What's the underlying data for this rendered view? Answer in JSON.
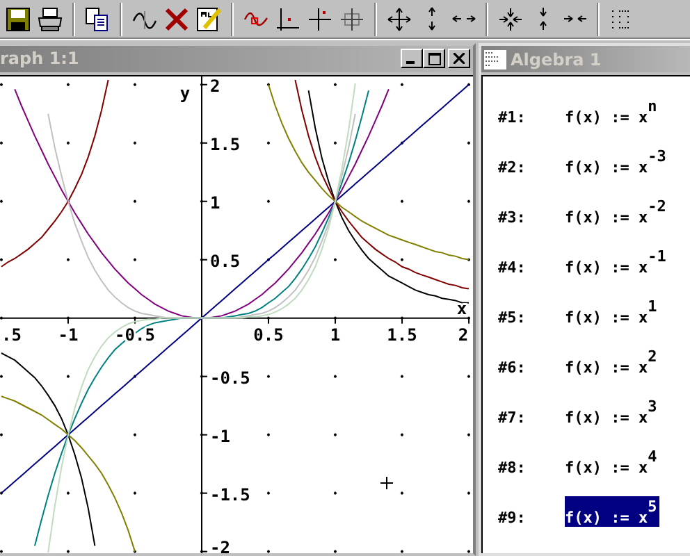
{
  "graph_window": {
    "title": "raph 1:1",
    "cut_tick_label": ".5",
    "chart_data": {
      "type": "line",
      "xlabel": "x",
      "ylabel": "y",
      "x": [
        -1.5,
        -1.45,
        -1.4,
        -1.35,
        -1.3,
        -1.25,
        -1.2,
        -1.15,
        -1.1,
        -1.05,
        -1,
        -0.95,
        -0.9,
        -0.85,
        -0.8,
        -0.75,
        -0.7,
        -0.65,
        -0.6,
        -0.55,
        -0.5,
        -0.45,
        -0.4,
        -0.35,
        -0.3,
        -0.25,
        -0.2,
        -0.15,
        -0.1,
        -0.05,
        0,
        0.05,
        0.1,
        0.15,
        0.2,
        0.25,
        0.3,
        0.35,
        0.4,
        0.45,
        0.5,
        0.55,
        0.6,
        0.65,
        0.7,
        0.75,
        0.8,
        0.85,
        0.9,
        0.95,
        1,
        1.05,
        1.1,
        1.15,
        1.2,
        1.25,
        1.3,
        1.35,
        1.4,
        1.45,
        1.5,
        1.55,
        1.6,
        1.65,
        1.7,
        1.75,
        1.8,
        1.85,
        1.9,
        1.95,
        2
      ],
      "series": [
        {
          "color": "#000000",
          "values": [
            -0.3,
            -0.33,
            -0.36,
            -0.41,
            -0.46,
            -0.51,
            -0.58,
            -0.66,
            -0.75,
            -0.86,
            -1,
            -1.17,
            -1.37,
            -1.63,
            -1.95,
            null,
            null,
            null,
            null,
            null,
            null,
            null,
            null,
            null,
            null,
            null,
            null,
            null,
            null,
            null,
            null,
            null,
            null,
            null,
            null,
            null,
            null,
            null,
            null,
            null,
            null,
            null,
            null,
            null,
            null,
            null,
            1.95,
            1.63,
            1.37,
            1.17,
            1,
            0.86,
            0.75,
            0.66,
            0.58,
            0.51,
            0.46,
            0.41,
            0.36,
            0.33,
            0.3,
            0.27,
            0.24,
            0.22,
            0.2,
            0.19,
            0.17,
            0.16,
            0.15,
            0.13,
            0.13
          ]
        },
        {
          "color": "#800000",
          "values": [
            0.44,
            0.48,
            0.51,
            0.55,
            0.59,
            0.64,
            0.69,
            0.76,
            0.83,
            0.91,
            1,
            1.11,
            1.23,
            1.38,
            1.56,
            1.78,
            2.04,
            null,
            null,
            null,
            null,
            null,
            null,
            null,
            null,
            null,
            null,
            null,
            null,
            null,
            null,
            null,
            null,
            null,
            null,
            null,
            null,
            null,
            null,
            null,
            null,
            null,
            null,
            null,
            2.04,
            1.78,
            1.56,
            1.38,
            1.23,
            1.11,
            1,
            0.91,
            0.83,
            0.76,
            0.69,
            0.64,
            0.59,
            0.55,
            0.51,
            0.48,
            0.44,
            0.42,
            0.39,
            0.37,
            0.35,
            0.33,
            0.31,
            0.29,
            0.28,
            0.26,
            0.25
          ]
        },
        {
          "color": "#808000",
          "values": [
            -0.67,
            -0.69,
            -0.71,
            -0.74,
            -0.77,
            -0.8,
            -0.83,
            -0.87,
            -0.91,
            -0.95,
            -1,
            -1.05,
            -1.11,
            -1.18,
            -1.25,
            -1.33,
            -1.43,
            -1.54,
            -1.67,
            -1.82,
            -2,
            null,
            null,
            null,
            null,
            null,
            null,
            null,
            null,
            null,
            null,
            null,
            null,
            null,
            null,
            null,
            null,
            null,
            null,
            null,
            2,
            1.82,
            1.67,
            1.54,
            1.43,
            1.33,
            1.25,
            1.18,
            1.11,
            1.05,
            1,
            0.95,
            0.91,
            0.87,
            0.83,
            0.8,
            0.77,
            0.74,
            0.71,
            0.69,
            0.67,
            0.65,
            0.63,
            0.61,
            0.59,
            0.57,
            0.56,
            0.54,
            0.53,
            0.51,
            0.5
          ]
        },
        {
          "color": "#000080",
          "values": [
            -1.5,
            -1.45,
            -1.4,
            -1.35,
            -1.3,
            -1.25,
            -1.2,
            -1.15,
            -1.1,
            -1.05,
            -1,
            -0.95,
            -0.9,
            -0.85,
            -0.8,
            -0.75,
            -0.7,
            -0.65,
            -0.6,
            -0.55,
            -0.5,
            -0.45,
            -0.4,
            -0.35,
            -0.3,
            -0.25,
            -0.2,
            -0.15,
            -0.1,
            -0.05,
            0,
            0.05,
            0.1,
            0.15,
            0.2,
            0.25,
            0.3,
            0.35,
            0.4,
            0.45,
            0.5,
            0.55,
            0.6,
            0.65,
            0.7,
            0.75,
            0.8,
            0.85,
            0.9,
            0.95,
            1,
            1.05,
            1.1,
            1.15,
            1.2,
            1.25,
            1.3,
            1.35,
            1.4,
            1.45,
            1.5,
            1.55,
            1.6,
            1.65,
            1.7,
            1.75,
            1.8,
            1.85,
            1.9,
            1.95,
            2
          ]
        },
        {
          "color": "#800080",
          "values": [
            null,
            null,
            1.96,
            1.82,
            1.69,
            1.56,
            1.44,
            1.32,
            1.21,
            1.1,
            1,
            0.9,
            0.81,
            0.72,
            0.64,
            0.56,
            0.49,
            0.42,
            0.36,
            0.3,
            0.25,
            0.2,
            0.16,
            0.12,
            0.09,
            0.06,
            0.04,
            0.02,
            0.01,
            0,
            0,
            0,
            0.01,
            0.02,
            0.04,
            0.06,
            0.09,
            0.12,
            0.16,
            0.2,
            0.25,
            0.3,
            0.36,
            0.42,
            0.49,
            0.56,
            0.64,
            0.72,
            0.81,
            0.9,
            1,
            1.1,
            1.21,
            1.32,
            1.44,
            1.56,
            1.69,
            1.82,
            1.96,
            null,
            null,
            null,
            null,
            null,
            null,
            null,
            null,
            null,
            null,
            null,
            null
          ]
        },
        {
          "color": "#008080",
          "values": [
            null,
            null,
            null,
            null,
            null,
            -1.95,
            -1.73,
            -1.52,
            -1.33,
            -1.16,
            -1,
            -0.86,
            -0.73,
            -0.61,
            -0.51,
            -0.42,
            -0.34,
            -0.27,
            -0.22,
            -0.17,
            -0.13,
            -0.09,
            -0.06,
            -0.04,
            -0.03,
            -0.02,
            -0.01,
            0,
            0,
            0,
            0,
            0,
            0,
            0,
            0.01,
            0.02,
            0.03,
            0.04,
            0.06,
            0.09,
            0.13,
            0.17,
            0.22,
            0.27,
            0.34,
            0.42,
            0.51,
            0.61,
            0.73,
            0.86,
            1,
            1.16,
            1.33,
            1.52,
            1.73,
            1.95,
            null,
            null,
            null,
            null,
            null,
            null,
            null,
            null,
            null,
            null,
            null,
            null,
            null,
            null,
            null
          ]
        },
        {
          "color": "#c0c0c0",
          "values": [
            null,
            null,
            null,
            null,
            null,
            null,
            null,
            1.75,
            1.46,
            1.22,
            1,
            0.81,
            0.66,
            0.52,
            0.41,
            0.32,
            0.24,
            0.18,
            0.13,
            0.09,
            0.06,
            0.04,
            0.03,
            0.02,
            0.01,
            0,
            0,
            0,
            0,
            0,
            0,
            0,
            0,
            0,
            0,
            0,
            0.01,
            0.02,
            0.03,
            0.04,
            0.06,
            0.09,
            0.13,
            0.18,
            0.24,
            0.32,
            0.41,
            0.52,
            0.66,
            0.81,
            1,
            1.22,
            1.46,
            1.75,
            null,
            null,
            null,
            null,
            null,
            null,
            null,
            null,
            null,
            null,
            null,
            null,
            null,
            null,
            null,
            null,
            null
          ]
        },
        {
          "color": "#c0dcc0",
          "values": [
            null,
            null,
            null,
            null,
            null,
            null,
            null,
            -2.01,
            -1.61,
            -1.28,
            -1,
            -0.77,
            -0.59,
            -0.44,
            -0.33,
            -0.24,
            -0.17,
            -0.12,
            -0.08,
            -0.05,
            -0.03,
            -0.02,
            -0.01,
            -0.01,
            0,
            0,
            0,
            0,
            0,
            0,
            0,
            0,
            0,
            0,
            0,
            0,
            0,
            0.01,
            0.01,
            0.02,
            0.03,
            0.05,
            0.08,
            0.12,
            0.17,
            0.24,
            0.33,
            0.44,
            0.59,
            0.77,
            1,
            1.28,
            1.61,
            2.01,
            null,
            null,
            null,
            null,
            null,
            null,
            null,
            null,
            null,
            null,
            null,
            null,
            null,
            null,
            null,
            null,
            null
          ]
        }
      ],
      "xlim": [
        -1.51,
        2.01
      ],
      "ylim": [
        -2.05,
        2.07
      ],
      "xticks": [
        -1,
        -0.5,
        0.5,
        1,
        1.5,
        2
      ],
      "yticks": [
        2,
        1.5,
        1,
        0.5,
        -0.5,
        -1,
        -1.5,
        -2
      ]
    }
  },
  "algebra_window": {
    "title": "Algebra 1",
    "entries": [
      {
        "label": "#1:",
        "expression": "f(x) := x$^{n}$",
        "selected": false
      },
      {
        "label": "#2:",
        "expression": "f(x) := x$^{-3}$",
        "selected": false
      },
      {
        "label": "#3:",
        "expression": "f(x) := x$^{-2}$",
        "selected": false
      },
      {
        "label": "#4:",
        "expression": "f(x) := x$^{-1}$",
        "selected": false
      },
      {
        "label": "#5:",
        "expression": "f(x) := x$^{1}$",
        "selected": false
      },
      {
        "label": "#6:",
        "expression": "f(x) := x$^{2}$",
        "selected": false
      },
      {
        "label": "#7:",
        "expression": "f(x) := x$^{3}$",
        "selected": false
      },
      {
        "label": "#8:",
        "expression": "f(x) := x$^{4}$",
        "selected": false
      },
      {
        "label": "#9:",
        "expression": "f(x) := x$^{5}$",
        "selected": true
      }
    ]
  }
}
